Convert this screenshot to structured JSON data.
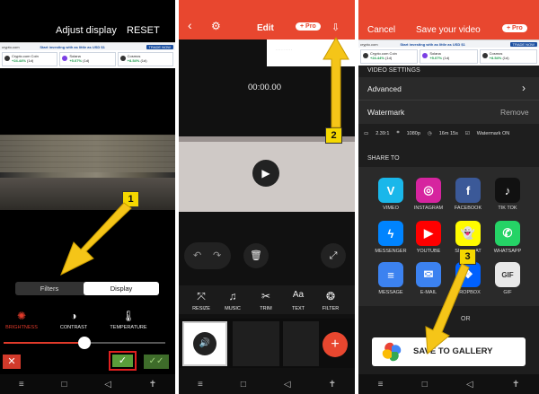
{
  "ad": {
    "brand": "crypto.com",
    "message": "Start investing with as little as USD $1",
    "cta": "TRADE NOW",
    "cards": [
      {
        "name": "Crypto.com Coin",
        "change": "+24.44%",
        "tag": "(1d)"
      },
      {
        "name": "Solana",
        "change": "+5.07%",
        "tag": "(1d)"
      },
      {
        "name": "Cosmos",
        "change": "+8.54%",
        "tag": "(1d)"
      }
    ]
  },
  "panel1": {
    "title": "Adjust display",
    "reset": "RESET",
    "tabs": [
      "Filters",
      "Display"
    ],
    "adjustments": [
      {
        "label": "BRIGHTNESS",
        "icon": "sun-icon",
        "active": true
      },
      {
        "label": "CONTRAST",
        "icon": "contrast-icon",
        "active": false
      },
      {
        "label": "TEMPERATURE",
        "icon": "thermometer-icon",
        "active": false
      }
    ],
    "slider_value": 0.5,
    "badge": "1"
  },
  "panel2": {
    "title": "Edit",
    "pro": "Pro",
    "time": "00:00.00",
    "tools": [
      {
        "label": "RESIZE",
        "glyph": "⤧"
      },
      {
        "label": "MUSIC",
        "glyph": "♫"
      },
      {
        "label": "TRIM",
        "glyph": "✂"
      },
      {
        "label": "TEXT",
        "glyph": "Aa"
      },
      {
        "label": "FILTER",
        "glyph": "❂"
      }
    ],
    "add": "+",
    "badge": "2"
  },
  "panel3": {
    "cancel": "Cancel",
    "title": "Save your video",
    "pro": "Pro",
    "video_settings": "VIDEO SETTINGS",
    "advanced": "Advanced",
    "watermark": "Watermark",
    "remove": "Remove",
    "specs": [
      "2.39:1",
      "1080p",
      "16m 15s",
      "Watermark ON"
    ],
    "share_to": "SHARE TO",
    "share": [
      {
        "label": "VIMEO",
        "glyph": "V",
        "color": "#1ab7ea"
      },
      {
        "label": "INSTAGRAM",
        "glyph": "◎",
        "color": "#d6249f"
      },
      {
        "label": "FACEBOOK",
        "glyph": "f",
        "color": "#3b5998"
      },
      {
        "label": "TIK TOK",
        "glyph": "♪",
        "color": "#111111"
      },
      {
        "label": "MESSENGER",
        "glyph": "ϟ",
        "color": "#0084ff"
      },
      {
        "label": "YOUTUBE",
        "glyph": "▶",
        "color": "#ff0000"
      },
      {
        "label": "SNAPCHAT",
        "glyph": "👻",
        "color": "#fffc00"
      },
      {
        "label": "WHATSAPP",
        "glyph": "✆",
        "color": "#25d366"
      },
      {
        "label": "MESSAGE",
        "glyph": "≡",
        "color": "#3c82f0"
      },
      {
        "label": "E-MAIL",
        "glyph": "✉",
        "color": "#3c82f0"
      },
      {
        "label": "DROPBOX",
        "glyph": "❖",
        "color": "#0061ff"
      },
      {
        "label": "GIF",
        "glyph": "GIF",
        "color": "#e8e8e8"
      }
    ],
    "or": "OR",
    "save_gallery": "SAVE TO GALLERY",
    "badge": "3"
  }
}
